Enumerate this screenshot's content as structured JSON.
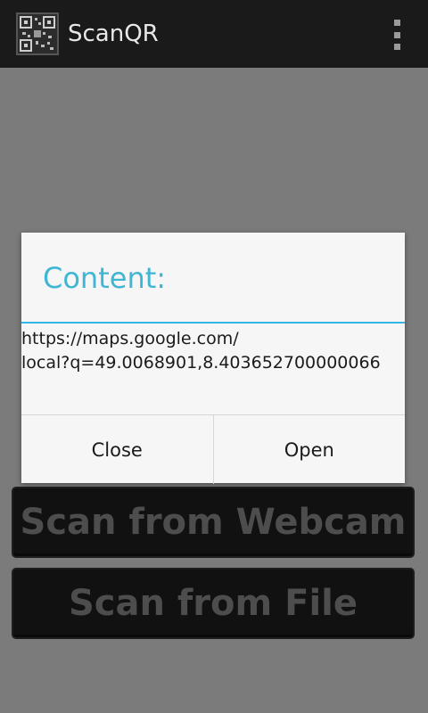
{
  "actionbar": {
    "title": "ScanQR",
    "icon": "qr-code-icon",
    "overflow_icon": "overflow-menu-icon"
  },
  "main": {
    "scan_webcam_label": "Scan from Webcam",
    "scan_file_label": "Scan from File"
  },
  "dialog": {
    "title": "Content:",
    "message_lines": [
      "https://maps.google.com/",
      "local?q=49.0068901,8.403652700000066"
    ],
    "close_label": "Close",
    "open_label": "Open"
  },
  "colors": {
    "accent": "#33b5e5",
    "title_text": "#40b6d4",
    "actionbar_bg": "#1a1a1a"
  }
}
